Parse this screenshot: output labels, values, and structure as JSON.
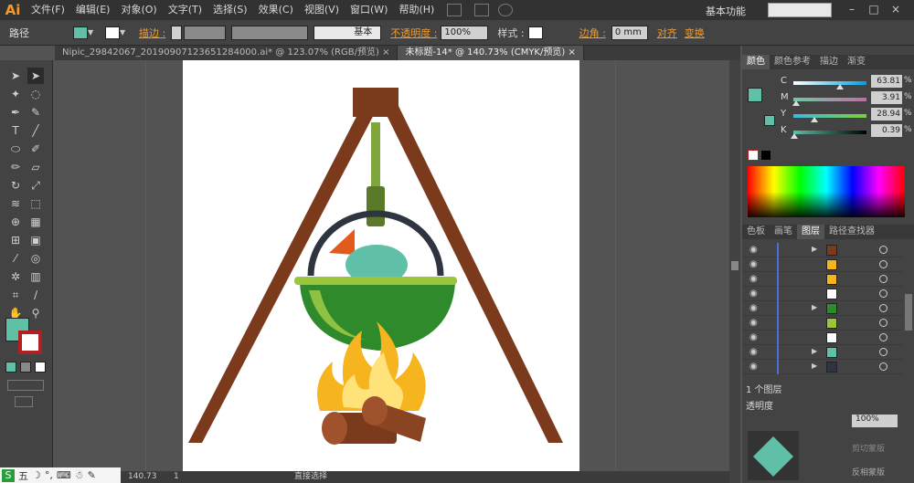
{
  "menubar": {
    "logo": "Ai",
    "items": [
      "文件(F)",
      "编辑(E)",
      "对象(O)",
      "文字(T)",
      "选择(S)",
      "效果(C)",
      "视图(V)",
      "窗口(W)",
      "帮助(H)"
    ],
    "workspace": "基本功能",
    "window_buttons": [
      "–",
      "□",
      "×"
    ]
  },
  "controlbar": {
    "selection_label": "路径",
    "stroke_label": "描边 :",
    "brush_label": "基本",
    "opacity_label": "不透明度 :",
    "opacity_value": "100%",
    "style_label": "样式 :",
    "corner_label": "边角 :",
    "corner_value": "0 mm",
    "align_label": "对齐",
    "transform_label": "变换",
    "fill_color": "#5fbfa7"
  },
  "tabs": [
    {
      "label": "Nipic_29842067_20190907123651284000.ai* @ 123.07% (RGB/预览)",
      "close": "×"
    },
    {
      "label": "未标题-14* @ 140.73% (CMYK/预览)",
      "close": "×"
    }
  ],
  "statusbar": {
    "zoom": "140.73",
    "page": "1",
    "tool": "直接选择"
  },
  "color_panel": {
    "tabs": [
      "颜色",
      "颜色参考",
      "描边",
      "渐变"
    ],
    "channels": [
      {
        "name": "C",
        "value": "63.81",
        "pos": 0.64
      },
      {
        "name": "M",
        "value": "3.91",
        "pos": 0.04
      },
      {
        "name": "Y",
        "value": "28.94",
        "pos": 0.29
      },
      {
        "name": "K",
        "value": "0.39",
        "pos": 0.01
      }
    ],
    "pct": "%"
  },
  "layers_panel": {
    "tabs": [
      "色板",
      "画笔",
      "图层",
      "路径查找器"
    ],
    "status": "1 个图层",
    "rows": 9
  },
  "bottom_panel": {
    "tab": "透明度",
    "opacity": "100%",
    "item1": "剪切蒙版",
    "item2": "反相蒙版"
  },
  "taskbar": {
    "ime": "五"
  },
  "colors": {
    "accent": "#f29a2b",
    "fill": "#5fbfa7"
  }
}
